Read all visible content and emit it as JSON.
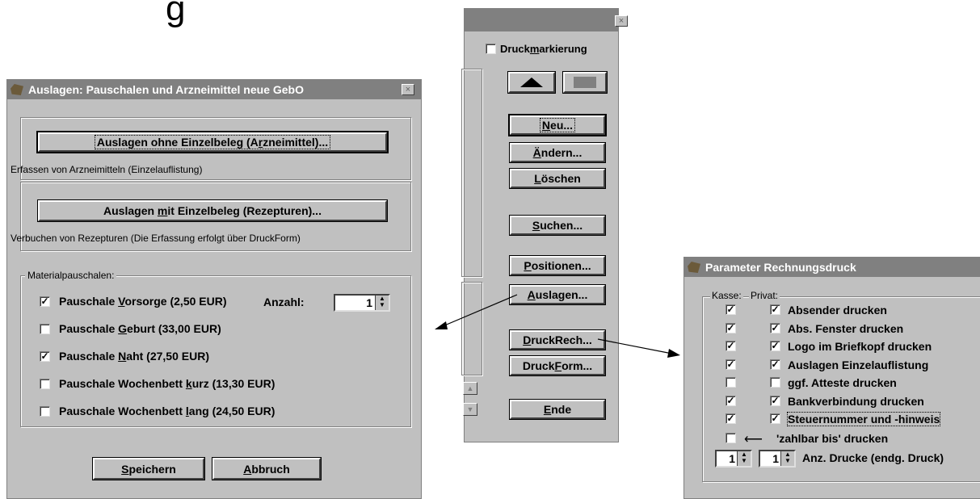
{
  "top_partial_char": "g",
  "dialog1": {
    "title": "Auslagen: Pauschalen und Arzneimittel neue GebO",
    "close_label": "×",
    "btn_ohne": {
      "pre": "Auslagen ohne Einzelbeleg (A",
      "acc": "r",
      "post": "zneimittel)..."
    },
    "ohne_desc": "Erfassen von Arzneimitteln (Einzelauflistung)",
    "btn_mit": {
      "pre": "Auslagen ",
      "acc": "m",
      "post": "it Einzelbeleg (Rezepturen)..."
    },
    "mit_desc": "Verbuchen von Rezepturen (Die Erfassung erfolgt über DruckForm)",
    "group_label": "Materialpauschalen:",
    "items": [
      {
        "pre": "Pauschale ",
        "acc": "V",
        "post": "orsorge (2,50 EUR)",
        "checked": true
      },
      {
        "pre": "Pauschale ",
        "acc": "G",
        "post": "eburt (33,00 EUR)",
        "checked": false
      },
      {
        "pre": "Pauschale ",
        "acc": "N",
        "post": "aht (27,50 EUR)",
        "checked": true
      },
      {
        "pre": "Pauschale Wochenbett ",
        "acc": "k",
        "post": "urz (13,30 EUR)",
        "checked": false
      },
      {
        "pre": "Pauschale Wochenbett ",
        "acc": "l",
        "post": "ang (24,50 EUR)",
        "checked": false
      }
    ],
    "anzahl_label": "Anzahl:",
    "anzahl_value": "1",
    "btn_speichern": {
      "acc": "S",
      "post": "peichern"
    },
    "btn_abbruch": {
      "acc": "A",
      "post": "bbruch"
    }
  },
  "panel2": {
    "close_label": "×",
    "druckmarkierung": {
      "pre": "Druck",
      "acc": "m",
      "post": "arkierung",
      "checked": false
    },
    "buttons": [
      {
        "name": "neu-button",
        "acc": "N",
        "post": "eu...",
        "pre": ""
      },
      {
        "name": "aendern-button",
        "acc": "Ä",
        "post": "ndern...",
        "pre": ""
      },
      {
        "name": "loeschen-button",
        "acc": "L",
        "post": "öschen",
        "pre": ""
      },
      {
        "name": "suchen-button",
        "acc": "S",
        "post": "uchen...",
        "pre": ""
      },
      {
        "name": "positionen-button",
        "acc": "P",
        "post": "ositionen...",
        "pre": ""
      },
      {
        "name": "auslagen-button",
        "acc": "A",
        "post": "uslagen...",
        "pre": ""
      },
      {
        "name": "druckrech-button",
        "acc": "D",
        "post": "ruckRech...",
        "pre": ""
      },
      {
        "name": "druckform-button",
        "pre": "Druck",
        "acc": "F",
        "post": "orm..."
      },
      {
        "name": "ende-button",
        "acc": "E",
        "post": "nde",
        "pre": ""
      }
    ]
  },
  "dialog3": {
    "title": "Parameter Rechnungsdruck",
    "kasse_label": "Kasse:",
    "privat_label": "Privat:",
    "rows": [
      {
        "kasse": true,
        "privat": true,
        "label": "Absender drucken"
      },
      {
        "kasse": true,
        "privat": true,
        "label": "Abs. Fenster drucken"
      },
      {
        "kasse": true,
        "privat": true,
        "label": "Logo im Briefkopf drucken"
      },
      {
        "kasse": true,
        "privat": true,
        "label": "Auslagen Einzelauflistung"
      },
      {
        "kasse": false,
        "privat": false,
        "label": "ggf. Atteste drucken"
      },
      {
        "kasse": true,
        "privat": true,
        "label": "Bankverbindung drucken"
      },
      {
        "kasse": true,
        "privat": true,
        "label": "Steuernummer und -hinweis"
      }
    ],
    "zahlbar_label": "'zahlbar bis' drucken",
    "zahlbar_checked": false,
    "spin1": "1",
    "spin2": "1",
    "anz_label": "Anz. Drucke (endg. Druck)"
  }
}
